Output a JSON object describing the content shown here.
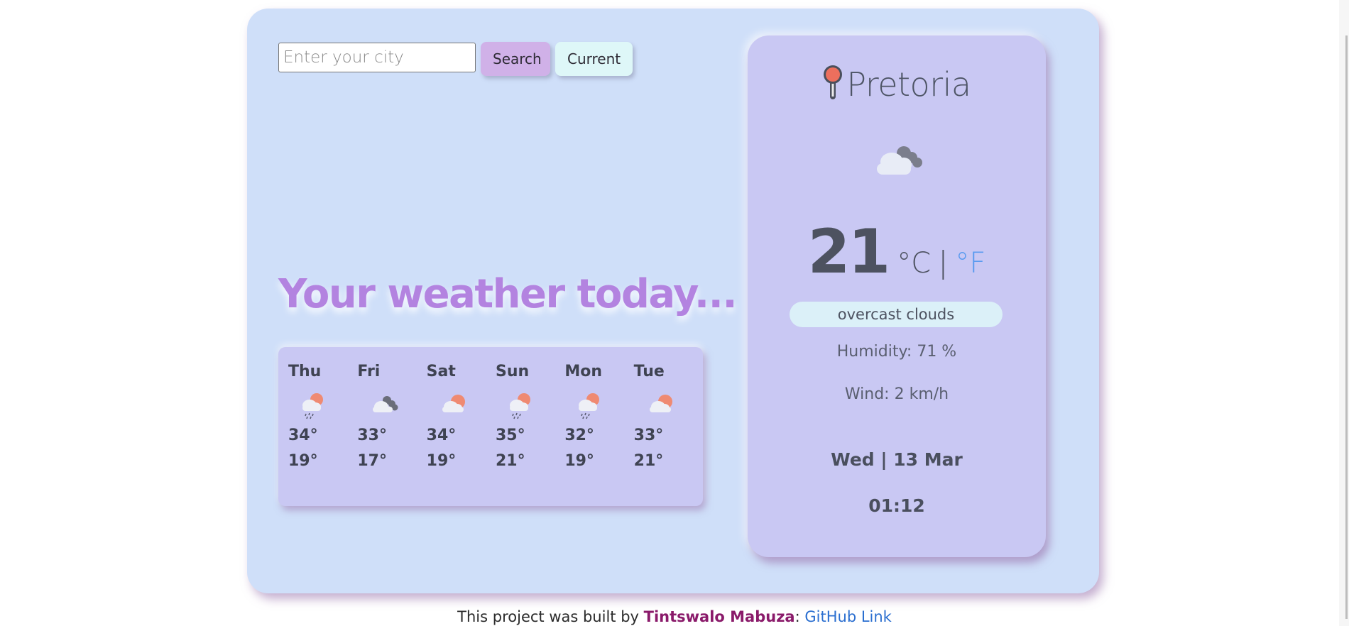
{
  "search": {
    "placeholder": "Enter your city",
    "value": "",
    "search_label": "Search",
    "current_label": "Current"
  },
  "headline": "Your weather today...",
  "forecast": [
    {
      "day": "Thu",
      "icon": "rain-sun-cloud-icon",
      "max": "34°",
      "min": "19°"
    },
    {
      "day": "Fri",
      "icon": "overcast-clouds-icon",
      "max": "33°",
      "min": "17°"
    },
    {
      "day": "Sat",
      "icon": "sun-cloud-icon",
      "max": "34°",
      "min": "19°"
    },
    {
      "day": "Sun",
      "icon": "rain-sun-cloud-icon",
      "max": "35°",
      "min": "21°"
    },
    {
      "day": "Mon",
      "icon": "rain-sun-cloud-icon",
      "max": "32°",
      "min": "19°"
    },
    {
      "day": "Tue",
      "icon": "sun-cloud-icon",
      "max": "33°",
      "min": "21°"
    }
  ],
  "current": {
    "city": "Pretoria",
    "location_icon": "map-pin-icon",
    "condition_icon": "overcast-clouds-icon",
    "temperature": "21",
    "unit_celsius": "°C",
    "unit_separator": "|",
    "unit_fahrenheit": "°F",
    "description": "overcast clouds",
    "humidity": "Humidity: 71 %",
    "wind": "Wind: 2 km/h",
    "date": "Wed | 13 Mar",
    "time": "01:12"
  },
  "footer": {
    "prefix": "This project was built by ",
    "author": "Tintswalo Mabuza",
    "separator": ": ",
    "link_label": "GitHub Link"
  },
  "colors": {
    "page_bg": "#cfdff9",
    "card_bg": "#c9c8f3",
    "headline": "#b383e0",
    "search_button": "#d0b1e8",
    "current_button": "#def7f8",
    "fahrenheit_link": "#5b9bf0",
    "author": "#8a1a6a"
  }
}
